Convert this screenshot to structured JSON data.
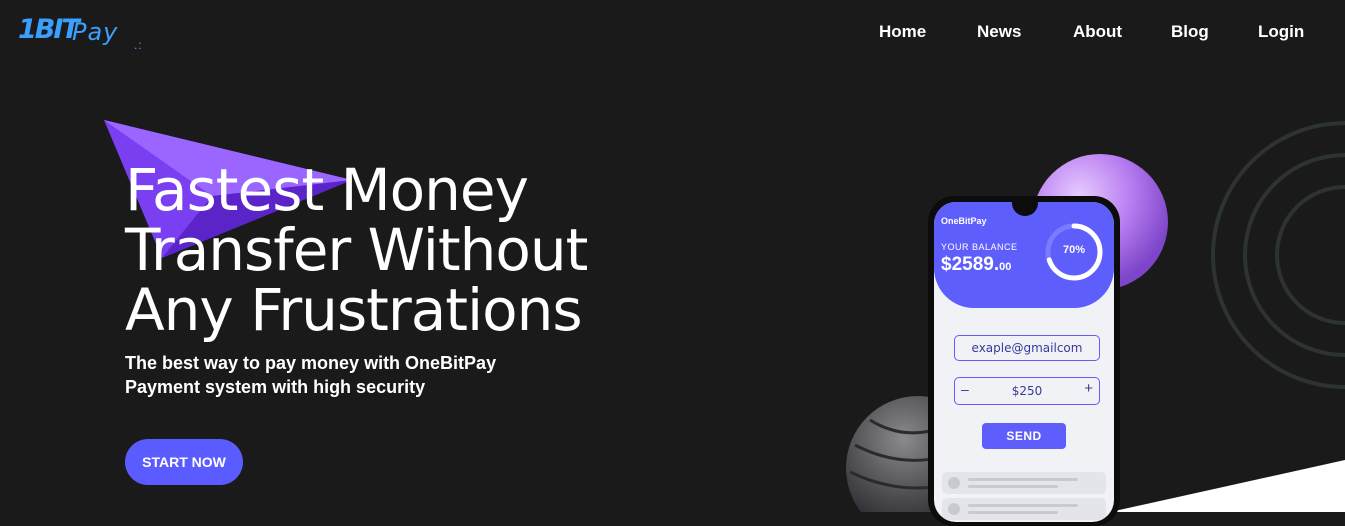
{
  "logo": {
    "mark": "1BIT",
    "suffix": "Pay",
    "dots": ".:"
  },
  "nav": {
    "items": [
      "Home",
      "News",
      "About",
      "Blog",
      "Login"
    ]
  },
  "hero": {
    "title_lines": [
      "Fastest Money",
      "Transfer Without",
      "Any Frustrations"
    ],
    "subtitle_lines": [
      "The best way to pay money with OneBitPay",
      "Payment system with high security"
    ],
    "cta_label": "START NOW"
  },
  "phone": {
    "app_name": "OneBitPay",
    "balance_label": "YOUR BALANCE",
    "balance_main": "$2589.",
    "balance_cents": "00",
    "progress_percent": 70,
    "progress_label": "70%",
    "email_value": "exaple@gmailcom",
    "amount_value": "$250",
    "minus_symbol": "–",
    "plus_symbol": "+",
    "send_label": "SEND"
  },
  "colors": {
    "background": "#1a1a1b",
    "accent": "#5b5cff",
    "logo": "#3aa0ff",
    "sphere_purple": "#b77cf0"
  }
}
